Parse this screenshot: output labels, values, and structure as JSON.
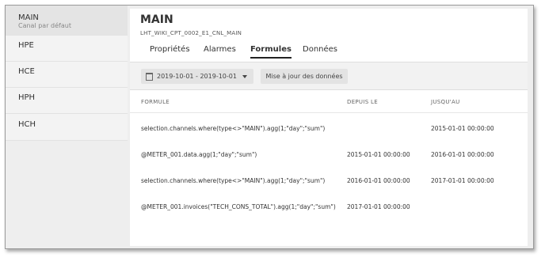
{
  "sidebar": {
    "items": [
      {
        "label": "MAIN",
        "sublabel": "Canal par défaut"
      },
      {
        "label": "HPE"
      },
      {
        "label": "HCE"
      },
      {
        "label": "HPH"
      },
      {
        "label": "HCH"
      }
    ]
  },
  "panel": {
    "title": "MAIN",
    "subtitle": "LHT_WIKI_CPT_0002_E1_CNL_MAIN",
    "tabs": [
      "Propriétés",
      "Alarmes",
      "Formules",
      "Données"
    ],
    "active_tab": "Formules"
  },
  "toolbar": {
    "date_range": "2019-10-01 - 2019-10-01",
    "update_label": "Mise à jour des données"
  },
  "table": {
    "headers": [
      "FORMULE",
      "DEPUIS LE",
      "JUSQU'AU"
    ],
    "rows": [
      {
        "formula": "selection.channels.where(type<>\"MAIN\").agg(1;\"day\";\"sum\")",
        "since": "",
        "until": "2015-01-01 00:00:00"
      },
      {
        "formula": "@METER_001.data.agg(1;\"day\";\"sum\")",
        "since": "2015-01-01 00:00:00",
        "until": "2016-01-01 00:00:00"
      },
      {
        "formula": "selection.channels.where(type<>\"MAIN\").agg(1;\"day\";\"sum\")",
        "since": "2016-01-01 00:00:00",
        "until": "2017-01-01 00:00:00"
      },
      {
        "formula": "@METER_001.invoices(\"TECH_CONS_TOTAL\").agg(1;\"day\";\"sum\")",
        "since": "2017-01-01 00:00:00",
        "until": ""
      }
    ]
  }
}
